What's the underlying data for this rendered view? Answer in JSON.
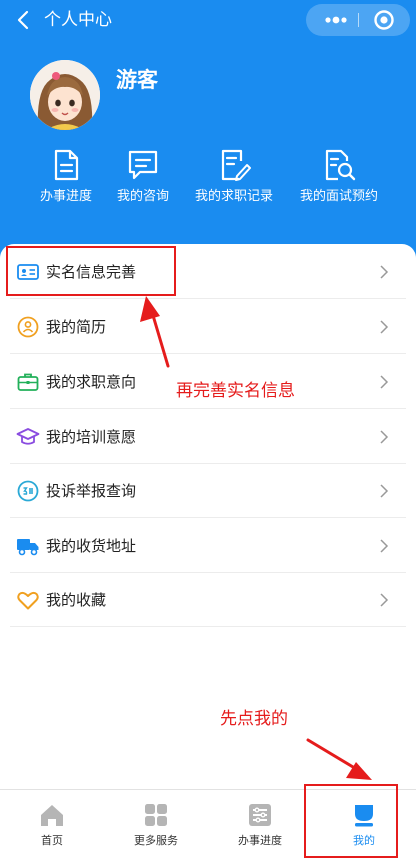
{
  "navbar": {
    "title": "个人中心"
  },
  "profile": {
    "name": "游客"
  },
  "quick_actions": [
    {
      "label": "办事进度",
      "icon": "document-icon"
    },
    {
      "label": "我的咨询",
      "icon": "chat-icon"
    },
    {
      "label": "我的求职记录",
      "icon": "edit-document-icon"
    },
    {
      "label": "我的面试预约",
      "icon": "document-search-icon"
    }
  ],
  "menu": [
    {
      "label": "实名信息完善",
      "icon": "id-card-icon",
      "color": "#1a8cf0"
    },
    {
      "label": "我的简历",
      "icon": "resume-icon",
      "color": "#f0a020"
    },
    {
      "label": "我的求职意向",
      "icon": "briefcase-icon",
      "color": "#22b05a"
    },
    {
      "label": "我的培训意愿",
      "icon": "graduation-cap-icon",
      "color": "#8a4ce0"
    },
    {
      "label": "投诉举报查询",
      "icon": "complaint-icon",
      "color": "#2aa9d6"
    },
    {
      "label": "我的收货地址",
      "icon": "truck-icon",
      "color": "#1a8cf0"
    },
    {
      "label": "我的收藏",
      "icon": "heart-icon",
      "color": "#f0a020"
    }
  ],
  "menu_arrow": ">",
  "annotations": {
    "step2": "再完善实名信息",
    "step1": "先点我的"
  },
  "tabbar": [
    {
      "label": "首页",
      "icon": "home-icon"
    },
    {
      "label": "更多服务",
      "icon": "grid-icon"
    },
    {
      "label": "办事进度",
      "icon": "list-icon"
    },
    {
      "label": "我的",
      "icon": "user-icon",
      "active": true
    }
  ],
  "colors": {
    "brand": "#1a8cf0",
    "annotation": "#e51c1c"
  }
}
